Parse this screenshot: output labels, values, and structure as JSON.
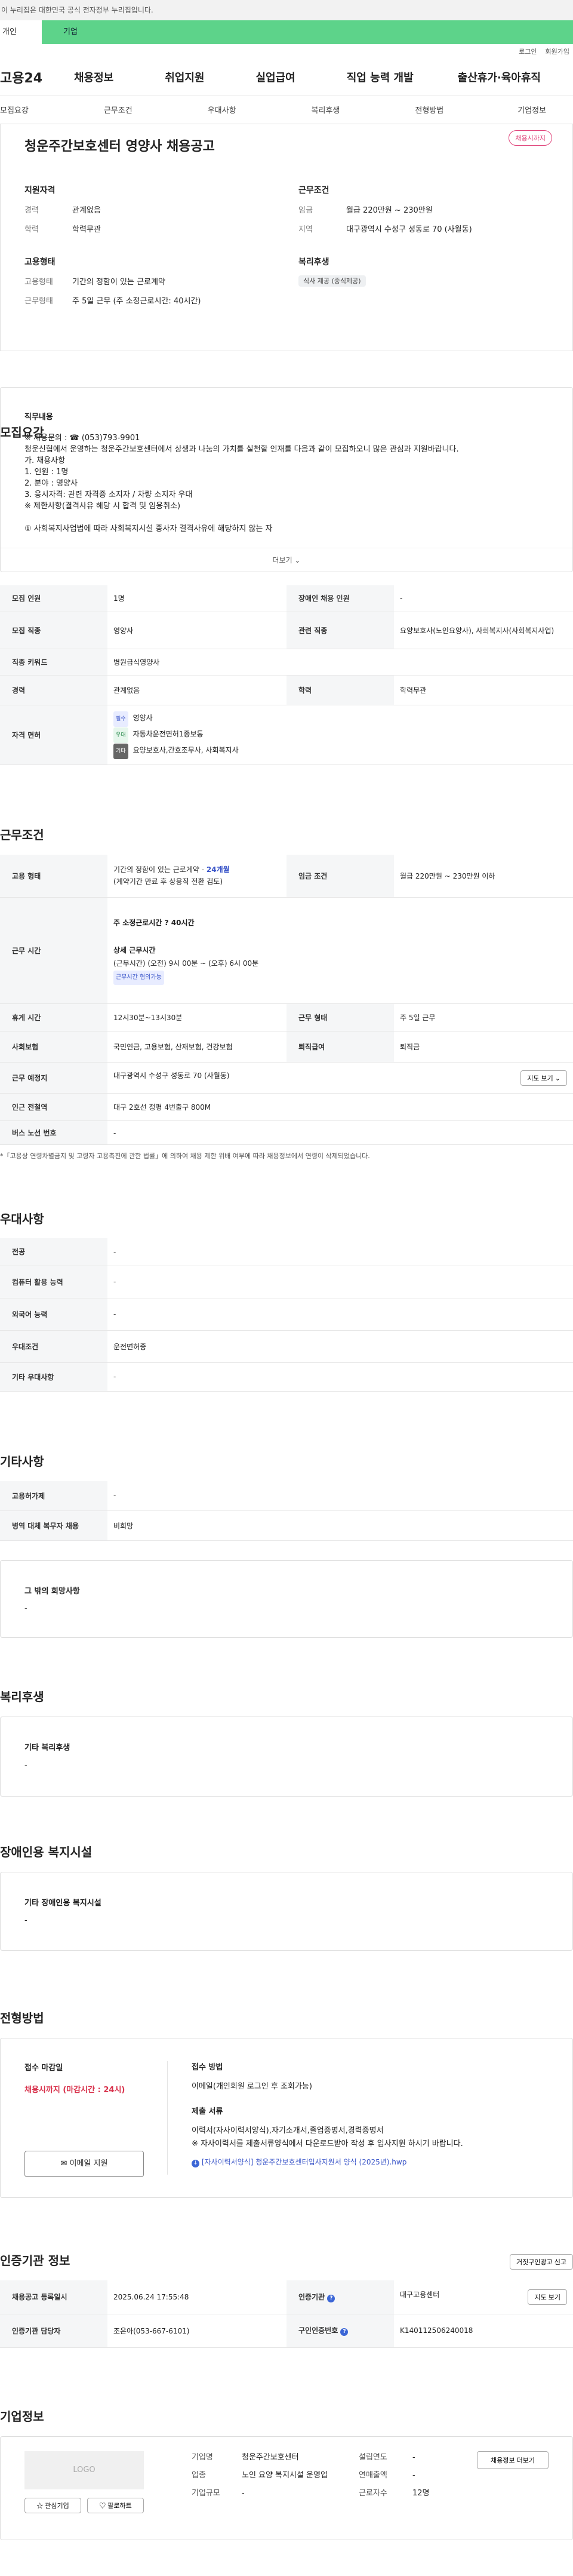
{
  "gov_banner": "이 누리집은 대한민국 공식 전자정부 누리집입니다.",
  "top_tabs": [
    "개인",
    "기업"
  ],
  "util": [
    "로그인",
    "회원가입"
  ],
  "gnb": {
    "logo": "고용24",
    "menus": [
      "채용정보",
      "취업지원",
      "실업급여",
      "직업 능력 개발",
      "출산휴가·육아휴직"
    ]
  },
  "subnav": [
    "모집요강",
    "근무조건",
    "우대사항",
    "복리후생",
    "전형방법",
    "기업정보"
  ],
  "header": {
    "title": "청운주간보호센터 영양사 채용공고",
    "badge": "채용시까지",
    "qual": {
      "h": "지원자격",
      "rows": [
        [
          "경력",
          "관계없음"
        ],
        [
          "학력",
          "학력무관"
        ]
      ]
    },
    "cond": {
      "h": "근무조건",
      "rows": [
        [
          "임금",
          "월급 220만원 ~ 230만원"
        ],
        [
          "지역",
          "대구광역시 수성구 성동로 70 (사월동)"
        ]
      ]
    },
    "emp": {
      "h": "고용형태",
      "rows": [
        [
          "고용형태",
          "기간의 정함이 있는 근로계약"
        ],
        [
          "근무형태",
          "주 5일 근무 (주 소정근로시간: 40시간)"
        ]
      ]
    },
    "welfare": {
      "h": "복리후생",
      "chip": "식사 제공 (중식제공)"
    }
  },
  "recruit": {
    "section": "모집요강",
    "desc_title": "직무내용",
    "desc_lines": [
      "※ 채용문의 : ☎ (053)793-9901",
      "청운신협에서 운영하는 청운주간보호센터에서 상생과 나눔의 가치를 실천할 인재를 다음과 같이 모집하오니 많은 관심과 지원바랍니다.",
      "가. 채용사항",
      " 1. 인원 : 1명",
      " 2. 분야 : 영양사",
      " 3. 응시자격: 관련 자격증 소지자 / 차량 소지자 우대",
      "※ 제한사항(결격사유 해당 시 합격 및 임용취소)",
      "",
      "① 사회복지사업법에 따라 사회복지시설 종사자 결격사유에 해당하지 않는 자"
    ],
    "more": "더보기 ⌄",
    "rows": [
      {
        "k1": "모집 인원",
        "v1": "1명",
        "k2": "장애인 채용 인원",
        "v2": "-"
      },
      {
        "k1": "모집 직종",
        "v1": "영양사",
        "k2": "관련 직종",
        "v2": "요양보호사(노인요양사), 사회복지사(사회복지사업)"
      },
      {
        "k1": "직종 키워드",
        "v1": "병원급식영양사"
      },
      {
        "k1": "경력",
        "v1": "관계없음",
        "k2": "학력",
        "v2": "학력무관"
      }
    ],
    "license_label": "자격 면허",
    "licenses": [
      {
        "tag": "필수",
        "name": "영양사"
      },
      {
        "tag": "우대",
        "name": "자동차운전면허1종보통"
      },
      {
        "tag": "기타",
        "name": "요양보호사,간호조무사, 사회복지사"
      }
    ]
  },
  "work": {
    "section": "근무조건",
    "emp_type_label": "고용 형태",
    "emp_type": "기간의 정함이 있는 근로계약",
    "emp_type_period": "24개월",
    "emp_type_note": "(계약기간 만료 후 상용직 전환 검토)",
    "wage_label": "임금 조건",
    "wage": "월급 220만원 ~ 230만원 이하",
    "hours_label": "근무 시간",
    "hours_weekly": "주 소정근로시간 ? 40시간",
    "hours_detail_title": "상세 근무시간",
    "hours_detail": "(근무시간) (오전) 9시 00분 ~ (오후) 6시 00분",
    "hours_chip": "근무시간 협의가능",
    "rows": [
      {
        "k1": "휴게 시간",
        "v1": "12시30분~13시30분",
        "k2": "근무 형태",
        "v2": "주 5일 근무"
      },
      {
        "k1": "사회보험",
        "v1": "국민연금, 고용보험, 산재보험, 건강보험",
        "k2": "퇴직급여",
        "v2": "퇴직금"
      }
    ],
    "place_label": "근무 예정지",
    "place": "대구광역시 수성구 성동로 70 (사월동)",
    "map_btn": "지도 보기 ⌄",
    "station_label": "인근 전철역",
    "station": "대구 2호선 정평 4번출구 800M",
    "bus_label": "버스 노선 번호",
    "bus": "-",
    "note": "*「고용상 연령차별금지 및 고령자 고용촉진에 관한 법률」에 의하여 채용 제한 위배 여부에 따라 채용정보에서 연령이 삭제되었습니다."
  },
  "pref": {
    "section": "우대사항",
    "rows": [
      [
        "전공",
        "-"
      ],
      [
        "컴퓨터 활용 능력",
        "-"
      ],
      [
        "외국어 능력",
        "-"
      ],
      [
        "우대조건",
        "운전면허증"
      ],
      [
        "기타 우대사항",
        "-"
      ]
    ]
  },
  "etc": {
    "section": "기타사항",
    "rows": [
      [
        "고용허가제",
        "-"
      ],
      [
        "병역 대체 복무자 채용",
        "비희망"
      ]
    ],
    "box_title": "그 밖의 희망사항",
    "box_value": "-"
  },
  "benefit": {
    "section": "복리후생",
    "box_title": "기타 복리후생",
    "box_value": "-"
  },
  "disability": {
    "section": "장애인용 복지시설",
    "box_title": "기타 장애인용 복지시설",
    "box_value": "-"
  },
  "process": {
    "section": "전형방법",
    "deadline_label": "접수 마감일",
    "deadline": "채용시까지 (마감시간 : 24시)",
    "email_btn": "이메일 지원",
    "method_label": "접수 방법",
    "method": "이메일(개인회원 로그인 후 조회가능)",
    "docs_label": "제출 서류",
    "docs": "이력서(자사이력서양식),자기소개서,졸업증명서,경력증명서",
    "docs_note": "※ 자사이력서를 제출서류양식에서 다운로드받아 작성 후 입사지원 하시기 바랍니다.",
    "file": "[자사이력서양식] 청운주간보호센터입사지원서 양식 (2025년).hwp"
  },
  "cert": {
    "section": "인증기관 정보",
    "report_btn": "거짓구인광고 신고",
    "rows": [
      {
        "k1": "채용공고 등록일시",
        "v1": "2025.06.24 17:55:48",
        "k2": "인증기관",
        "v2": "대구고용센터",
        "btn": "지도 보기"
      },
      {
        "k1": "인증기관 담당자",
        "v1": "조은아(053-667-6101)",
        "k2": "구인인증번호",
        "v2": "K140112506240018"
      }
    ]
  },
  "company": {
    "section": "기업정보",
    "logo": "LOGO",
    "fav_btn": "관심기업",
    "follow_btn": "팔로하트",
    "info_btn": "채용정보 더보기",
    "fields": [
      {
        "k": "기업명",
        "v": "청운주간보호센터"
      },
      {
        "k": "업종",
        "v": "노인 요양 복지시설 운영업"
      },
      {
        "k": "기업규모",
        "v": "-"
      }
    ],
    "fields2": [
      {
        "k": "설립연도",
        "v": "-"
      },
      {
        "k": "연매출액",
        "v": "-"
      },
      {
        "k": "근로자수",
        "v": "12명"
      }
    ]
  }
}
